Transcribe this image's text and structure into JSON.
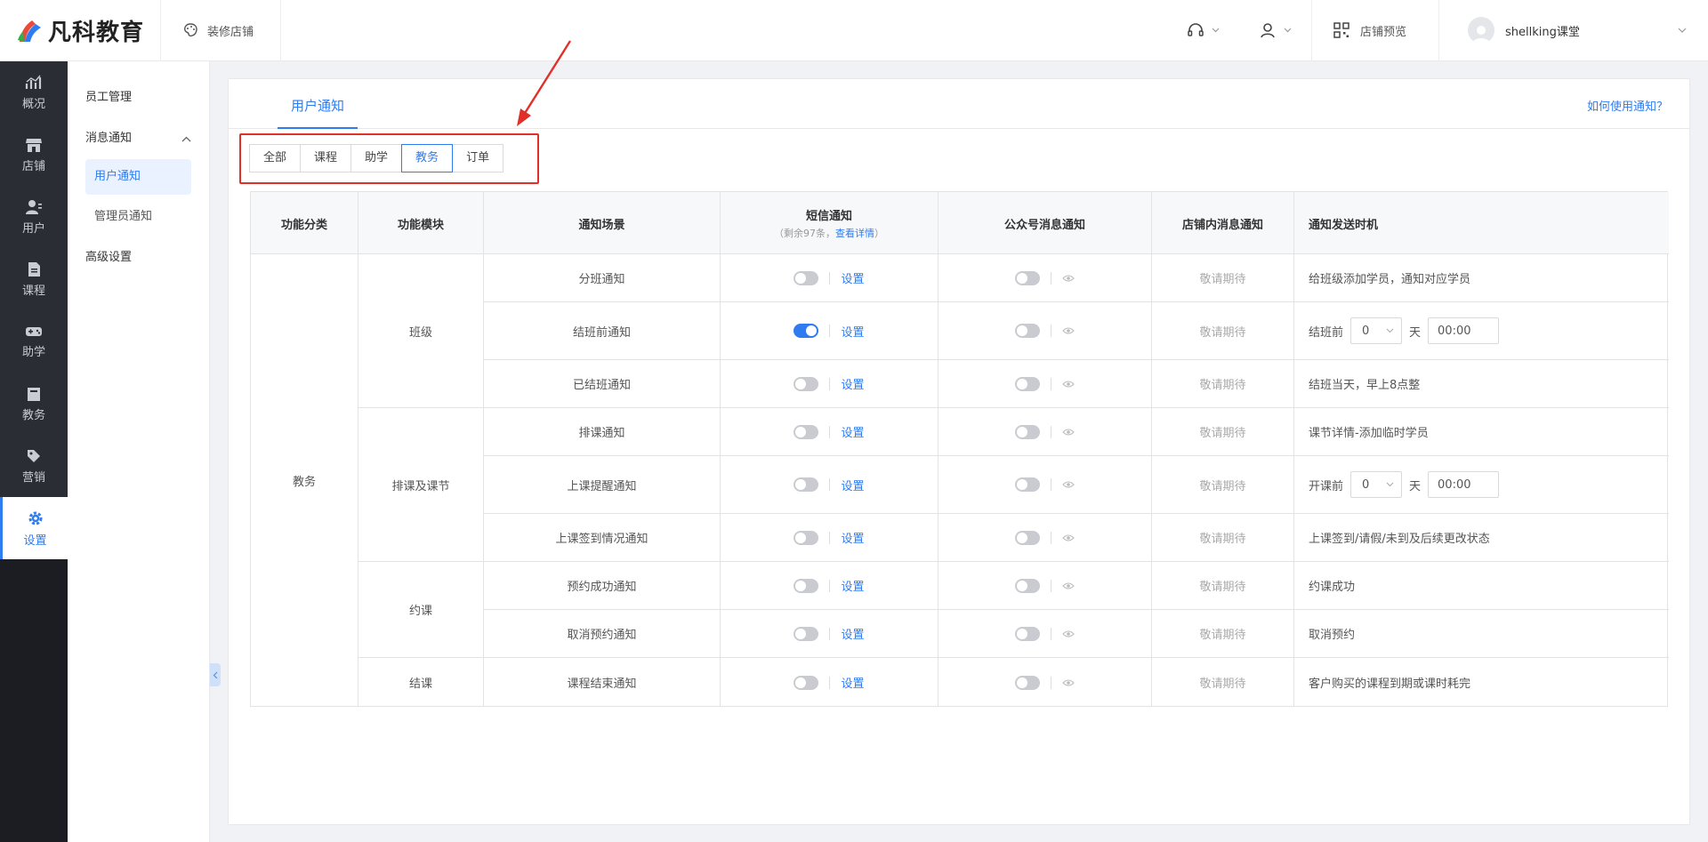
{
  "brand": {
    "name": "凡科教育"
  },
  "topbar": {
    "decorate_label": "装修店铺",
    "preview_label": "店铺预览",
    "account_name": "shellking课堂"
  },
  "leftnav": [
    {
      "label": "概况",
      "icon": "chart-icon"
    },
    {
      "label": "店铺",
      "icon": "store-icon"
    },
    {
      "label": "用户",
      "icon": "users-icon"
    },
    {
      "label": "课程",
      "icon": "document-icon"
    },
    {
      "label": "助学",
      "icon": "gamepad-icon"
    },
    {
      "label": "教务",
      "icon": "calendar-icon"
    },
    {
      "label": "营销",
      "icon": "tag-icon"
    },
    {
      "label": "设置",
      "icon": "gear-icon"
    }
  ],
  "submenu": {
    "staff": "员工管理",
    "notify": "消息通知",
    "user_notify": "用户通知",
    "admin_notify": "管理员通知",
    "advanced": "高级设置"
  },
  "card": {
    "tab": "用户通知",
    "help": "如何使用通知？"
  },
  "filters": [
    "全部",
    "课程",
    "助学",
    "教务",
    "订单"
  ],
  "filter_active": "教务",
  "table": {
    "headers": {
      "category": "功能分类",
      "module": "功能模块",
      "scene": "通知场景",
      "sms": "短信通知",
      "sms_sub_prefix": "（剩余97条，",
      "sms_sub_link": "查看详情",
      "sms_sub_suffix": "）",
      "wechat": "公众号消息通知",
      "inshop": "店铺内消息通知",
      "timing": "通知发送时机"
    },
    "category": "教务",
    "modules": [
      "班级",
      "排课及课节",
      "约课",
      "结课"
    ],
    "set_label": "设置",
    "coming_soon": "敬请期待",
    "rows": [
      {
        "scene": "分班通知",
        "sms_on": false,
        "timing": "给班级添加学员，通知对应学员"
      },
      {
        "scene": "结班前通知",
        "sms_on": true,
        "timing_prefix": "结班前",
        "timing_days": "0",
        "timing_unit": "天",
        "timing_time": "00:00"
      },
      {
        "scene": "已结班通知",
        "sms_on": false,
        "timing": "结班当天，早上8点整"
      },
      {
        "scene": "排课通知",
        "sms_on": false,
        "timing": "课节详情-添加临时学员"
      },
      {
        "scene": "上课提醒通知",
        "sms_on": false,
        "timing_prefix": "开课前",
        "timing_days": "0",
        "timing_unit": "天",
        "timing_time": "00:00"
      },
      {
        "scene": "上课签到情况通知",
        "sms_on": false,
        "timing": "上课签到/请假/未到及后续更改状态"
      },
      {
        "scene": "预约成功通知",
        "sms_on": false,
        "timing": "约课成功"
      },
      {
        "scene": "取消预约通知",
        "sms_on": false,
        "timing": "取消预约"
      },
      {
        "scene": "课程结束通知",
        "sms_on": false,
        "timing": "客户购买的课程到期或课时耗完"
      }
    ]
  },
  "colors": {
    "accent": "#2f7cf0",
    "nav_bg": "#2a2d34",
    "highlight": "#e0302a"
  }
}
